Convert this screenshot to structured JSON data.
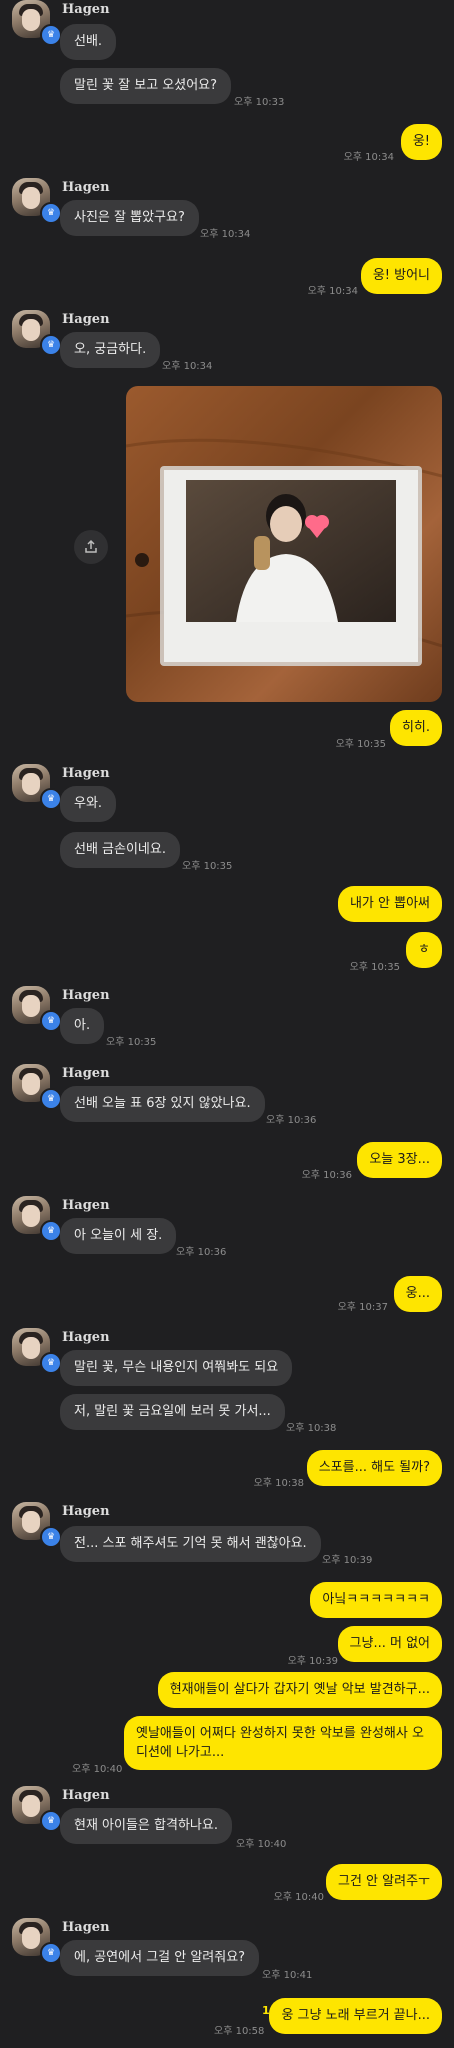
{
  "sender_name": "Hagen",
  "messages": {
    "m1": "선배.",
    "m2": "말린 꽃 잘 보고 오셨어요?",
    "t2": "오후 10:33",
    "o1": "웅!",
    "to1": "오후 10:34",
    "m3": "사진은 잘 뽑았구요?",
    "t3": "오후 10:34",
    "o2": "웅! 방어니",
    "to2": "오후 10:34",
    "m4": "오, 궁금하다.",
    "t4": "오후 10:34",
    "o3": "히히.",
    "to3": "오후 10:35",
    "m5": "우와.",
    "m6": "선배 금손이네요.",
    "t6": "오후 10:35",
    "o4": "내가 안 뽑아써",
    "o5": "ㅎ",
    "to5": "오후 10:35",
    "m7": "아.",
    "t7": "오후 10:35",
    "m8": "선배 오늘 표 6장 있지 않았나요.",
    "t8": "오후 10:36",
    "o6": "오늘 3장...",
    "to6": "오후 10:36",
    "m9": "아 오늘이 세 장.",
    "t9": "오후 10:36",
    "o7": "웅...",
    "to7": "오후 10:37",
    "m10": "말린 꽃, 무슨 내용인지 여쭤봐도 되요",
    "m11": "저, 말린 꽃 금요일에 보러 못 가서...",
    "t11": "오후 10:38",
    "o8": "스포를... 해도 될까?",
    "to8": "오후 10:38",
    "m12": "전... 스포 해주셔도 기억 못 해서 괜찮아요.",
    "t12": "오후 10:39",
    "o9": "아닠ㅋㅋㅋㅋㅋㅋㅋ",
    "o10": "그냥... 머 없어",
    "to10": "오후 10:39",
    "o11": "현재애들이 살다가 갑자기 옛날 악보 발견하구...",
    "o12": "옛날애들이 어쩌다 완성하지 못한 악보를 완성해사 오디션에 나가고...",
    "to12": "오후 10:40",
    "m13": "현재 아이들은 합격하나요.",
    "t13": "오후 10:40",
    "o13": "그건 안 알려주ㅜ",
    "to13": "오후 10:40",
    "m14": "에, 공연에서 그걸 안 알려줘요?",
    "t14": "오후 10:41",
    "unread": "1",
    "o14": "웅 그냥 노래 부르거 끝나...",
    "to14": "오후 10:58"
  },
  "colors": {
    "background": "#1f1f21",
    "incoming": "#3a3a3c",
    "outgoing": "#fee500",
    "badge": "#3b82e8"
  }
}
